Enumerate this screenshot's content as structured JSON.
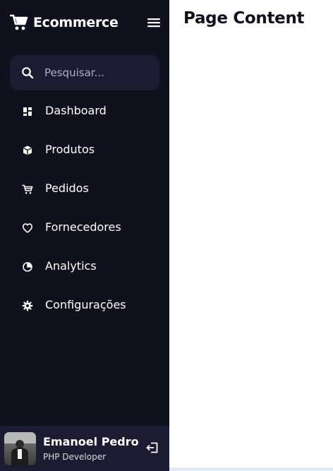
{
  "brand": {
    "name": "Ecommerce",
    "logo_icon": "cart-icon"
  },
  "header": {
    "menu_icon": "hamburger-menu-icon"
  },
  "search": {
    "placeholder": "Pesquisar...",
    "value": "",
    "icon": "search-icon"
  },
  "nav": {
    "items": [
      {
        "label": "Dashboard",
        "icon": "dashboard-icon"
      },
      {
        "label": "Produtos",
        "icon": "box-icon"
      },
      {
        "label": "Pedidos",
        "icon": "cart-icon"
      },
      {
        "label": "Fornecedores",
        "icon": "heart-icon"
      },
      {
        "label": "Analytics",
        "icon": "pie-chart-icon"
      },
      {
        "label": "Configurações",
        "icon": "gear-icon"
      }
    ]
  },
  "profile": {
    "name": "Emanoel Pedro",
    "role": "PHP Developer",
    "logout_icon": "logout-icon"
  },
  "main": {
    "title": "Page Content"
  },
  "colors": {
    "sidebar_bg": "#11101d",
    "panel_bg": "#1d1b31",
    "text": "#ffffff",
    "page_bg": "#ffffff"
  }
}
